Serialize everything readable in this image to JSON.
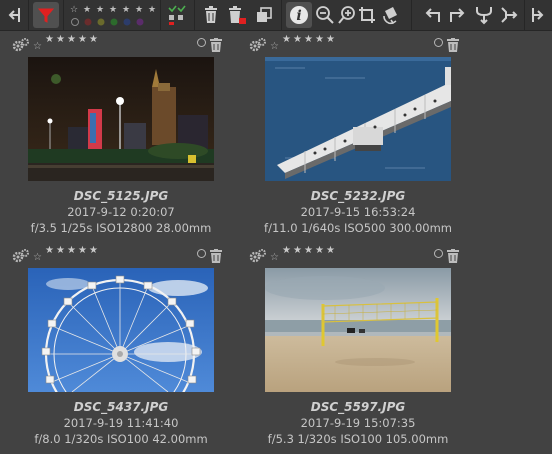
{
  "toolbar": {
    "icons": [
      "collapse-left-icon",
      "filter-icon",
      "star-rating-filter-icon",
      "color-label-filter-icon",
      "selection-status-icon",
      "delete-icon",
      "delete-from-disk-icon",
      "duplicate-icon",
      "info-icon",
      "zoom-out-icon",
      "zoom-in-icon",
      "crop-icon",
      "auto-transform-icon",
      "rotate-left-icon",
      "rotate-right-icon",
      "merge-icon",
      "move-right-icon",
      "collapse-right-icon"
    ],
    "colors": {
      "active_filter": "#e02020"
    }
  },
  "thumbnails": [
    {
      "filename": "DSC_5125.JPG",
      "datetime": "2017-9-12 0:20:07",
      "exif": "f/3.5 1/25s ISO12800 28.00mm"
    },
    {
      "filename": "DSC_5232.JPG",
      "datetime": "2017-9-15 16:53:24",
      "exif": "f/11.0 1/640s ISO500 300.00mm"
    },
    {
      "filename": "DSC_5437.JPG",
      "datetime": "2017-9-19 11:41:40",
      "exif": "f/8.0 1/320s ISO100 42.00mm"
    },
    {
      "filename": "DSC_5597.JPG",
      "datetime": "2017-9-19 15:07:35",
      "exif": "f/5.3 1/320s ISO100 105.00mm"
    }
  ]
}
